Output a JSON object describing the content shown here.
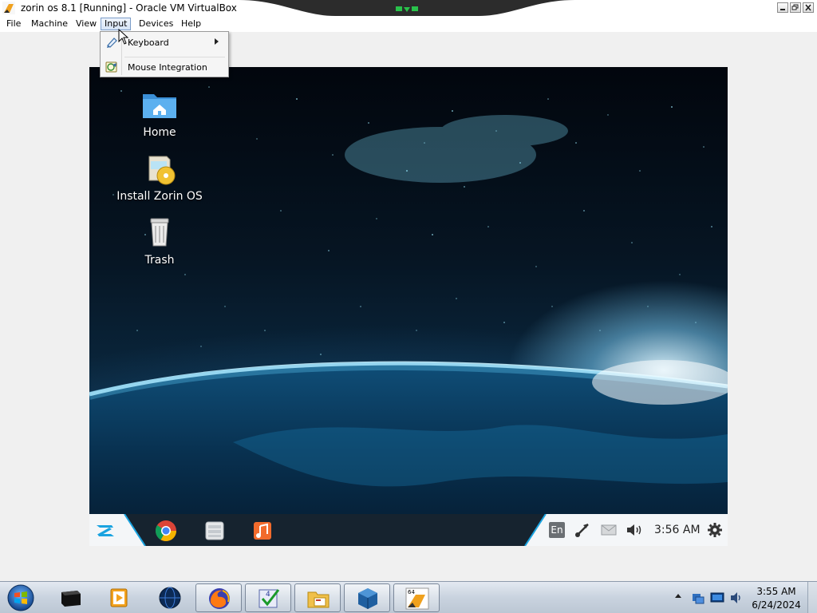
{
  "window": {
    "title": "zorin os 8.1 [Running] - Oracle VM VirtualBox"
  },
  "menu": {
    "items": [
      "File",
      "Machine",
      "View",
      "Input",
      "Devices",
      "Help"
    ],
    "active": "Input"
  },
  "input_menu": {
    "items": [
      {
        "label": "Keyboard",
        "icon": "keyboard-icon",
        "has_submenu": true
      },
      {
        "label": "Mouse Integration",
        "icon": "mouse-integration-icon",
        "has_submenu": false
      }
    ]
  },
  "vm_desktop": {
    "icons": [
      {
        "label": "Home",
        "icon": "home-folder-icon"
      },
      {
        "label": "Install Zorin OS",
        "icon": "installer-icon"
      },
      {
        "label": "Trash",
        "icon": "trash-icon"
      }
    ],
    "panel": {
      "launchers": [
        "zorin-menu-icon",
        "chrome-icon",
        "file-manager-icon",
        "music-player-icon"
      ],
      "keyboard_layout": "En",
      "clock": "3:56 AM",
      "tray_icons": [
        "network-icon",
        "mail-icon",
        "volume-icon",
        "settings-gear-icon"
      ]
    }
  },
  "host_taskbar": {
    "buttons": [
      "terminal-icon",
      "media-player-icon",
      "globe-icon",
      "firefox-icon",
      "checklist-app-icon",
      "folder-card-icon",
      "virtualbox-icon",
      "vmware-icon"
    ],
    "tray": {
      "time": "3:55 AM",
      "date": "6/24/2024"
    }
  },
  "colors": {
    "menu_active_border": "#7a9cc8",
    "vm_space_dark": "#02060d",
    "zorin_accent": "#1aa3e0",
    "taskbar_bg": "#c9d3df"
  }
}
